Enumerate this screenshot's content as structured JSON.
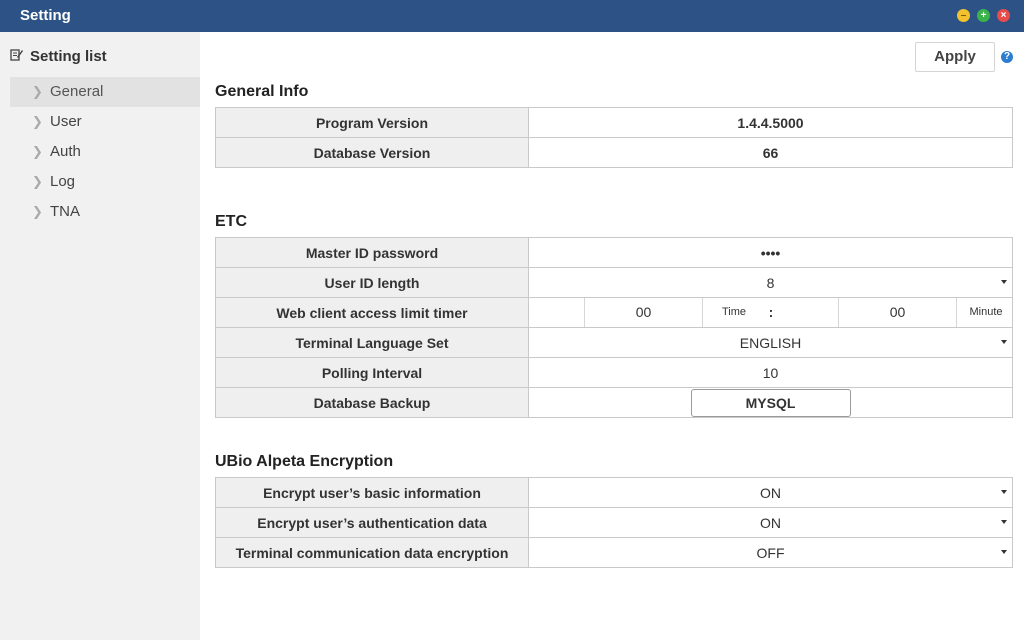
{
  "window": {
    "title": "Setting"
  },
  "sidebar": {
    "header": "Setting list",
    "items": [
      {
        "label": "General",
        "active": true
      },
      {
        "label": "User"
      },
      {
        "label": "Auth"
      },
      {
        "label": "Log"
      },
      {
        "label": "TNA"
      }
    ]
  },
  "toolbar": {
    "apply_label": "Apply",
    "help_icon": "?"
  },
  "general_info": {
    "title": "General Info",
    "program_version_label": "Program Version",
    "program_version_value": "1.4.4.5000",
    "database_version_label": "Database Version",
    "database_version_value": "66"
  },
  "etc": {
    "title": "ETC",
    "master_password_label": "Master ID password",
    "master_password_value": "••••",
    "user_id_length_label": "User ID length",
    "user_id_length_value": "8",
    "web_timer_label": "Web client access limit timer",
    "web_timer_hours": "00",
    "web_timer_time_unit": "Time",
    "web_timer_separator": ":",
    "web_timer_minutes": "00",
    "web_timer_minute_unit": "Minute",
    "terminal_language_label": "Terminal Language Set",
    "terminal_language_value": "ENGLISH",
    "polling_interval_label": "Polling Interval",
    "polling_interval_value": "10",
    "database_backup_label": "Database Backup",
    "database_backup_button": "MYSQL"
  },
  "encryption": {
    "title": "UBio Alpeta Encryption",
    "basic_info_label": "Encrypt user’s basic information",
    "basic_info_value": "ON",
    "auth_data_label": "Encrypt user’s authentication data",
    "auth_data_value": "ON",
    "terminal_comm_label": "Terminal communication data encryption",
    "terminal_comm_value": "OFF"
  }
}
